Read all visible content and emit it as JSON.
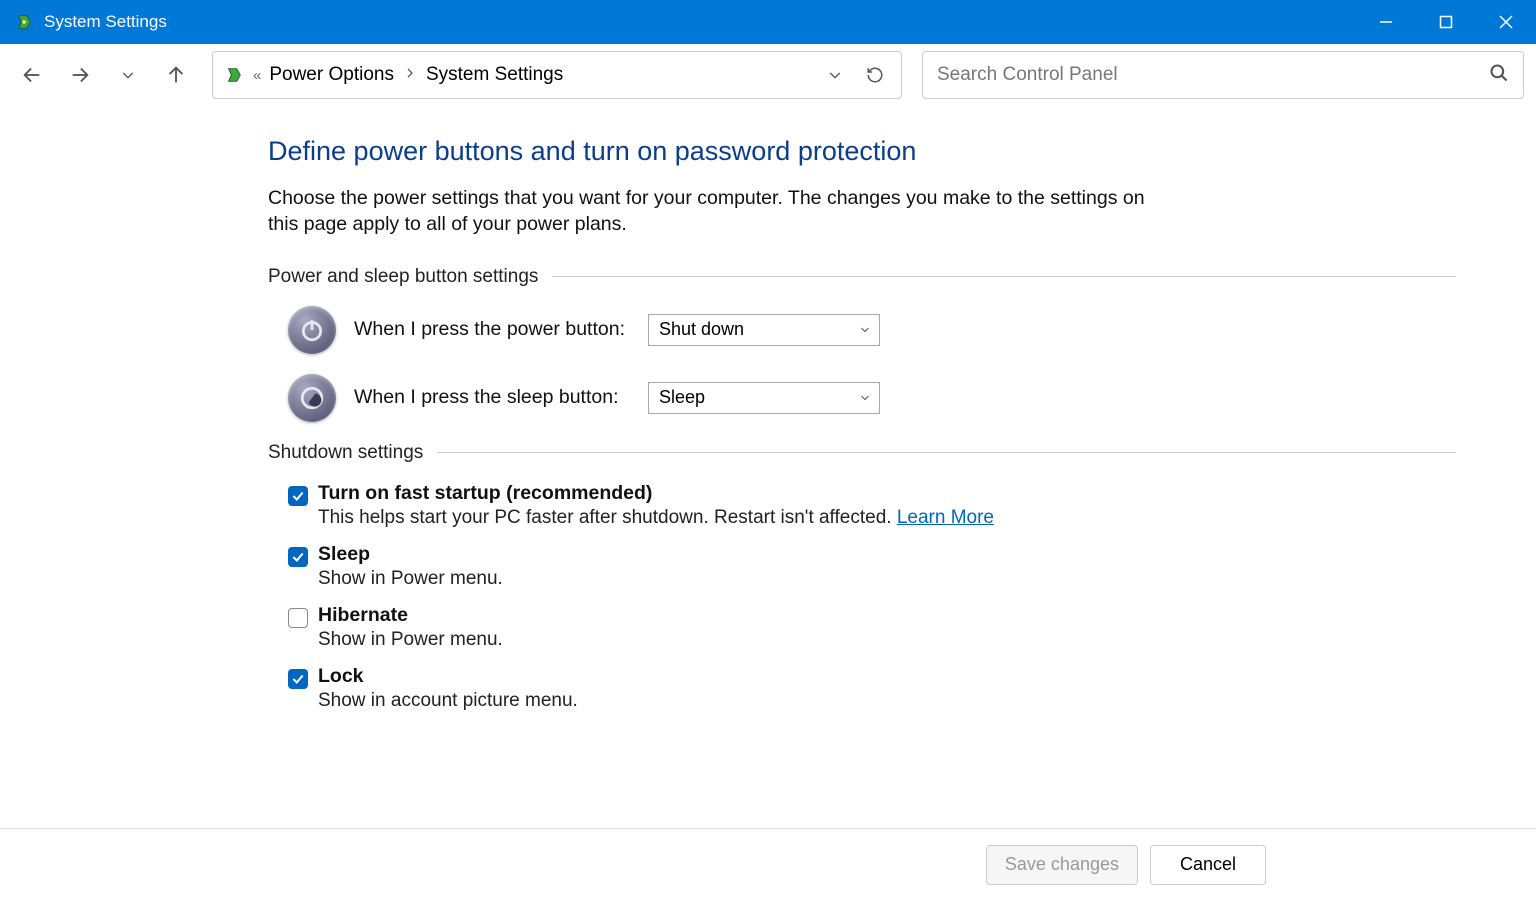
{
  "window": {
    "title": "System Settings"
  },
  "breadcrumb": {
    "parent": "Power Options",
    "current": "System Settings"
  },
  "search": {
    "placeholder": "Search Control Panel"
  },
  "page": {
    "title": "Define power buttons and turn on password protection",
    "description": "Choose the power settings that you want for your computer. The changes you make to the settings on this page apply to all of your power plans."
  },
  "section_buttons": {
    "header": "Power and sleep button settings",
    "power_label": "When I press the power button:",
    "power_value": "Shut down",
    "sleep_label": "When I press the sleep button:",
    "sleep_value": "Sleep"
  },
  "section_shutdown": {
    "header": "Shutdown settings",
    "items": [
      {
        "checked": true,
        "title": "Turn on fast startup (recommended)",
        "desc": "This helps start your PC faster after shutdown. Restart isn't affected. ",
        "link": "Learn More"
      },
      {
        "checked": true,
        "title": "Sleep",
        "desc": "Show in Power menu."
      },
      {
        "checked": false,
        "title": "Hibernate",
        "desc": "Show in Power menu."
      },
      {
        "checked": true,
        "title": "Lock",
        "desc": "Show in account picture menu."
      }
    ]
  },
  "footer": {
    "save": "Save changes",
    "cancel": "Cancel"
  }
}
